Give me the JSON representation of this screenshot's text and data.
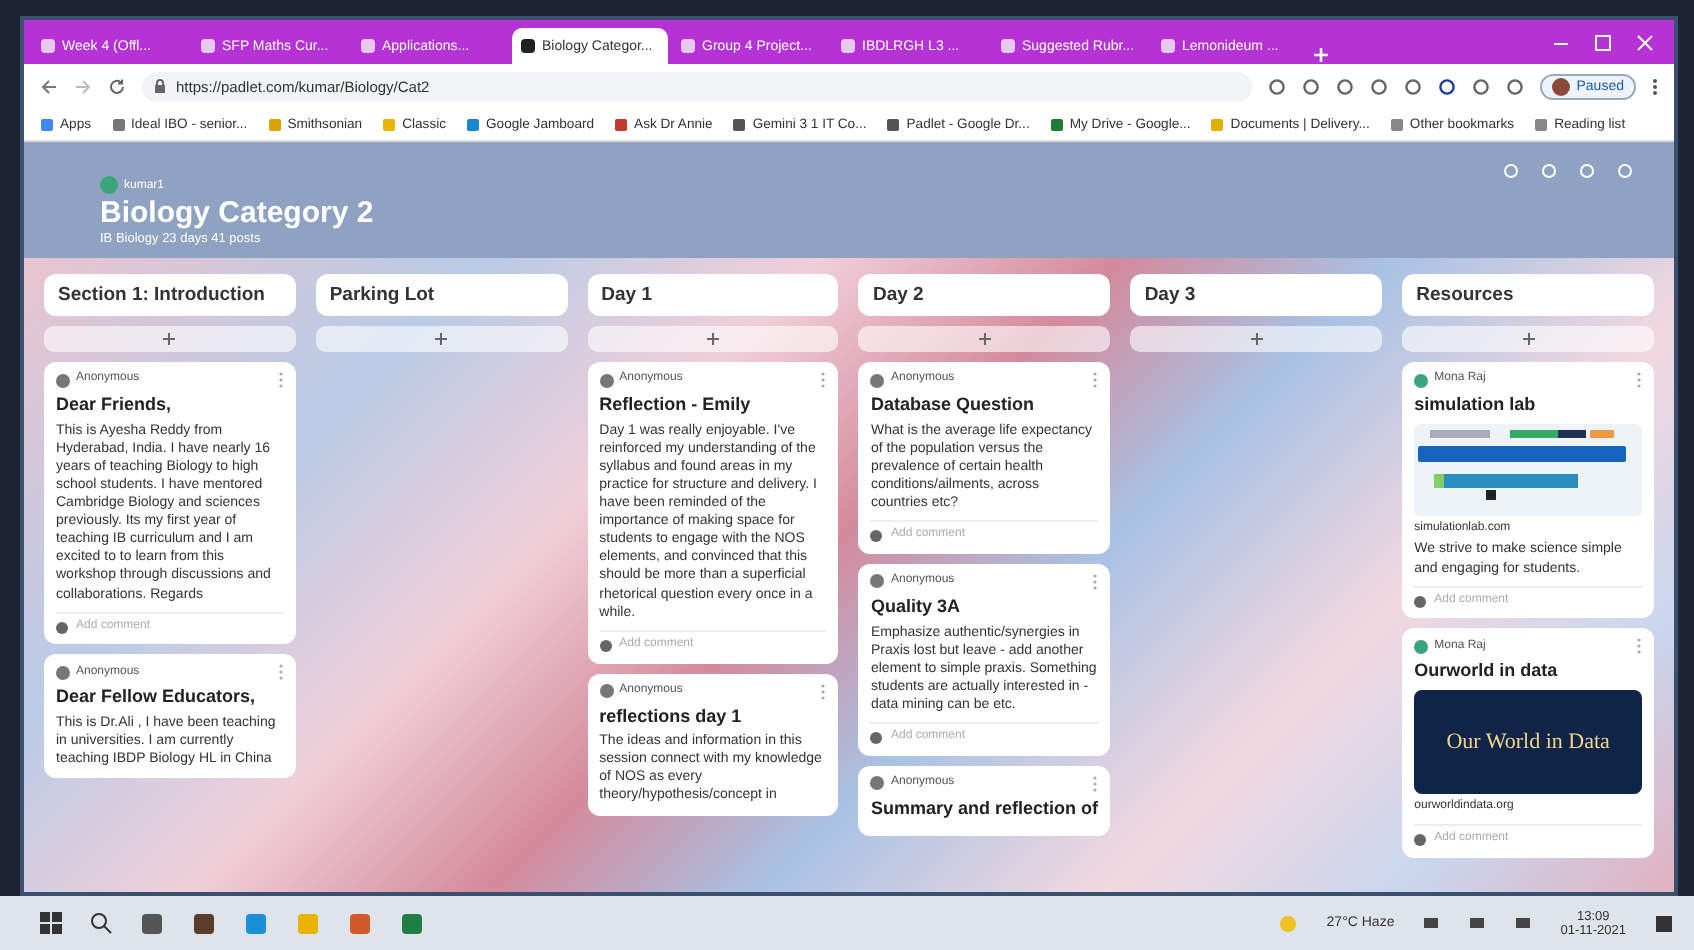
{
  "browser": {
    "tabs": [
      {
        "title": "Week 4 (Offl...",
        "selected": false
      },
      {
        "title": "SFP Maths Cur...",
        "selected": false
      },
      {
        "title": "Applications...",
        "selected": false
      },
      {
        "title": "Biology Categor...",
        "selected": true
      },
      {
        "title": "Group 4 Project...",
        "selected": false
      },
      {
        "title": "IBDLRGH L3 ...",
        "selected": false
      },
      {
        "title": "Suggested Rubr...",
        "selected": false
      },
      {
        "title": "Lemonideum ...",
        "selected": false
      }
    ],
    "url": "https://padlet.com/kumar/Biology/Cat2",
    "profile_label": "Paused",
    "bookmarks": [
      "Apps",
      "Ideal IBO - senior...",
      "Smithsonian",
      "Classic",
      "Google Jamboard",
      "Ask Dr Annie",
      "Gemini 3 1 IT Co...",
      "Padlet - Google Dr...",
      "My Drive - Google...",
      "Documents | Delivery...",
      "Other bookmarks",
      "Reading list"
    ]
  },
  "board": {
    "author": "kumar1",
    "title": "Biology Category 2",
    "subtitle": "IB Biology 23 days 41 posts",
    "columns": [
      {
        "title": "Section 1: Introduction",
        "cards": [
          {
            "kind": "text",
            "author": "Anonymous",
            "title": "Dear Friends,",
            "body": "This is Ayesha Reddy from Hyderabad, India. I have nearly 16 years of teaching Biology to high school students. I have mentored Cambridge Biology and sciences previously. Its my first year of teaching IB curriculum and I am excited to to learn from this workshop through discussions and collaborations. Regards",
            "comment": "Add comment"
          },
          {
            "kind": "text",
            "author": "Anonymous",
            "title": "Dear Fellow Educators,",
            "body": "This is Dr.Ali , I have been teaching in universities. I am currently teaching IBDP Biology HL in China"
          }
        ]
      },
      {
        "title": "Parking Lot"
      },
      {
        "title": "Day 1",
        "cards": [
          {
            "kind": "text",
            "author": "Anonymous",
            "title": "Reflection - Emily",
            "body": "Day 1 was really enjoyable. I've reinforced my understanding of the syllabus and found areas in my practice for structure and delivery. I have been reminded of the importance of making space for students to engage with the NOS elements, and convinced that this should be more than a superficial rhetorical question every once in a while.",
            "comment": "Add comment"
          },
          {
            "kind": "text",
            "author": "Anonymous",
            "title": "reflections day 1",
            "body": "The ideas and information in this session connect with my knowledge of NOS as every theory/hypothesis/concept in"
          }
        ]
      },
      {
        "title": "Day 2",
        "cards": [
          {
            "kind": "text",
            "author": "Anonymous",
            "title": "Database Question",
            "body": "What is the average life expectancy of the population versus the prevalence of certain health conditions/ailments, across countries etc?",
            "comment": "Add comment"
          },
          {
            "kind": "text",
            "author": "Anonymous",
            "title": "Quality 3A",
            "body": "Emphasize authentic/synergies in Praxis lost but leave - add another element to simple praxis. Something students are actually interested in - data mining can be etc.",
            "comment": "Add comment"
          },
          {
            "kind": "text",
            "author": "Anonymous",
            "title": "Summary and reflection of"
          }
        ]
      },
      {
        "title": "Day 3"
      },
      {
        "title": "Resources",
        "cards": [
          {
            "kind": "simulation",
            "author": "Mona Raj",
            "title": "simulation lab",
            "link": "simulationlab.com",
            "body": "We strive to make science simple and engaging for students.",
            "comment": "Add comment"
          },
          {
            "kind": "banner",
            "author": "Mona Raj",
            "title": "Ourworld in data",
            "banner_title": "Our World in Data",
            "link": "ourworldindata.org",
            "comment": "Add comment"
          }
        ]
      }
    ]
  },
  "taskbar": {
    "weather": "27°C Haze",
    "time": "13:09",
    "date": "01-11-2021"
  }
}
